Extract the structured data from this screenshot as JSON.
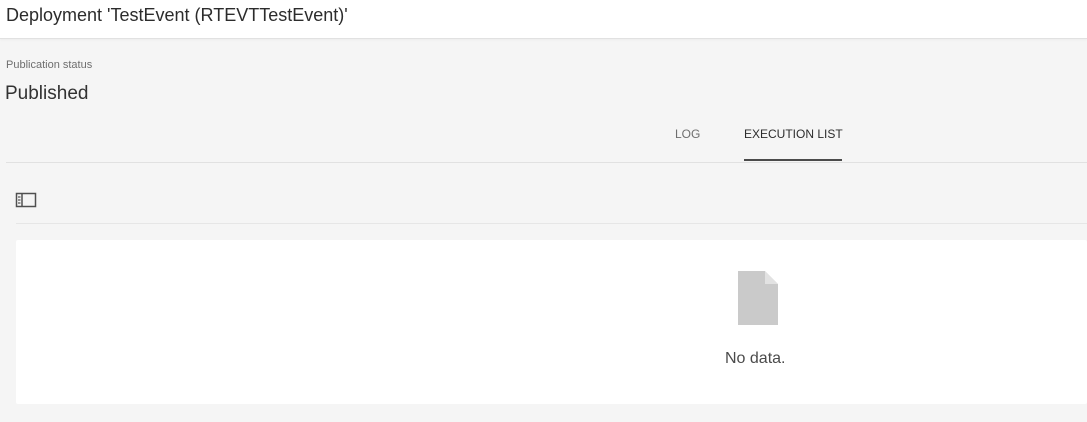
{
  "header": {
    "title": "Deployment 'TestEvent (RTEVTTestEvent)'"
  },
  "publication": {
    "label": "Publication status",
    "value": "Published"
  },
  "tabs": [
    {
      "label": "LOG",
      "active": false
    },
    {
      "label": "EXECUTION LIST",
      "active": true
    }
  ],
  "toolbar": {
    "panel_toggle_icon": "panel-toggle-icon"
  },
  "empty_state": {
    "icon": "document-icon",
    "message": "No data."
  },
  "colors": {
    "background": "#f5f5f5",
    "card": "#ffffff",
    "active_tab_underline": "#4b4b4b",
    "empty_icon": "#cacaca"
  }
}
